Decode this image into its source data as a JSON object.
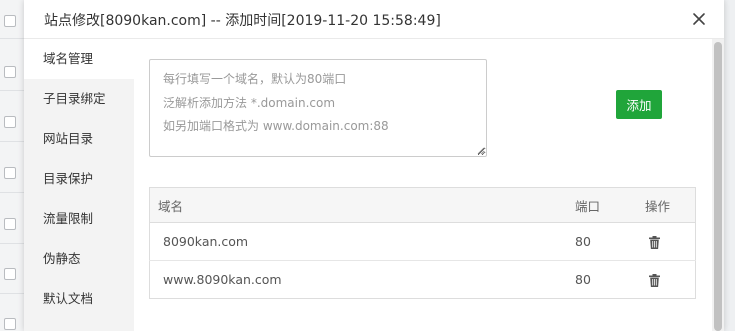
{
  "modal": {
    "title": "站点修改[8090kan.com] -- 添加时间[2019-11-20 15:58:49]",
    "close_icon": "close-icon"
  },
  "sidebar": {
    "items": [
      {
        "label": "域名管理",
        "active": true
      },
      {
        "label": "子目录绑定",
        "active": false
      },
      {
        "label": "网站目录",
        "active": false
      },
      {
        "label": "目录保护",
        "active": false
      },
      {
        "label": "流量限制",
        "active": false
      },
      {
        "label": "伪静态",
        "active": false
      },
      {
        "label": "默认文档",
        "active": false
      }
    ]
  },
  "domain_input": {
    "placeholder_lines": [
      "每行填写一个域名，默认为80端口",
      "泛解析添加方法 *.domain.com",
      "如另加端口格式为 www.domain.com:88"
    ],
    "value": ""
  },
  "add_button": {
    "label": "添加",
    "color": "#20a53a"
  },
  "table": {
    "headers": {
      "domain": "域名",
      "port": "端口",
      "op": "操作"
    },
    "rows": [
      {
        "domain": "8090kan.com",
        "port": "80",
        "op_icon": "trash-icon"
      },
      {
        "domain": "www.8090kan.com",
        "port": "80",
        "op_icon": "trash-icon"
      }
    ]
  }
}
